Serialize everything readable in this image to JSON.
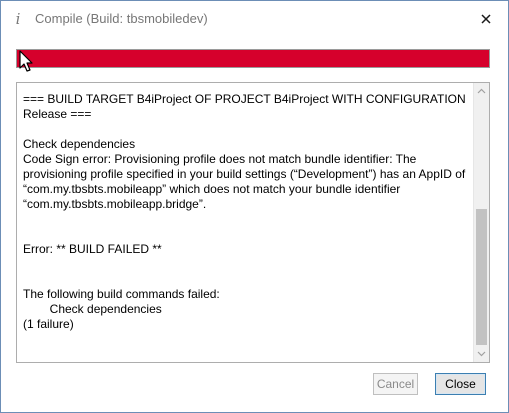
{
  "window": {
    "title": "Compile (Build: tbsmobiledev)",
    "title_icon": "info-icon",
    "close_icon": "close-icon"
  },
  "progress": {
    "value_percent": 100,
    "status_color": "#d6002c"
  },
  "log": {
    "text": "=== BUILD TARGET B4iProject OF PROJECT B4iProject WITH CONFIGURATION Release ===\n\nCheck dependencies\nCode Sign error: Provisioning profile does not match bundle identifier: The provisioning profile specified in your build settings (“Development”) has an AppID of “com.my.tbsbts.mobileapp” which does not match your bundle identifier “com.my.tbsbts.mobileapp.bridge”.\n\n\nError: ** BUILD FAILED **\n\n\nThe following build commands failed:\n\tCheck dependencies\n(1 failure)"
  },
  "buttons": {
    "cancel_label": "Cancel",
    "cancel_enabled": false,
    "close_label": "Close"
  },
  "colors": {
    "error_red": "#d6002c",
    "focus_blue": "#3c7fb1",
    "window_border": "#6c8eb6"
  }
}
